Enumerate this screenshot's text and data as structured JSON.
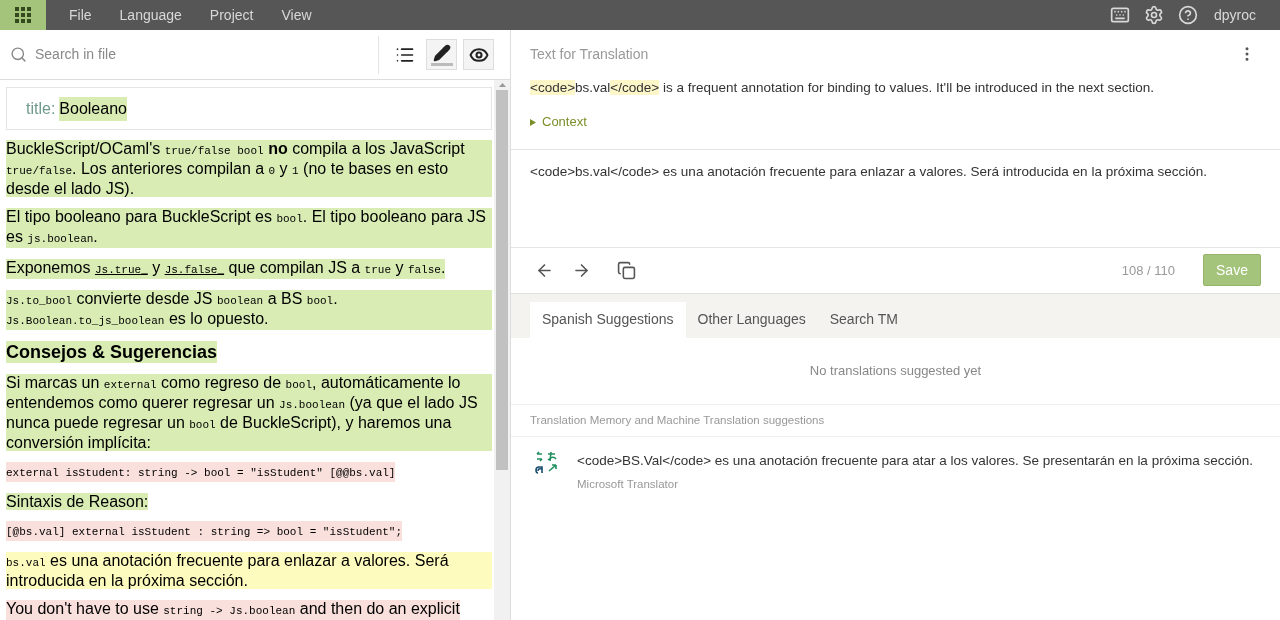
{
  "menu_bar": {
    "items": [
      "File",
      "Language",
      "Project",
      "View"
    ],
    "user": "dpyroc"
  },
  "document": {
    "search": {
      "placeholder": "Search in file"
    },
    "tools": [
      {
        "kind": "list",
        "active": false,
        "selected": false
      },
      {
        "kind": "edit",
        "active": true,
        "selected": true
      },
      {
        "kind": "preview",
        "active": true,
        "selected": false
      }
    ],
    "title_field": {
      "label": "title:",
      "value": "Booleano"
    },
    "blocks": [
      {
        "kind": "paragraph",
        "color": "#d9ecb4",
        "segments": [
          {
            "kind": "text",
            "text": "BuckleScript/OCaml's "
          },
          {
            "kind": "code",
            "text": "true/false bool"
          },
          {
            "kind": "text",
            "text": " **no** compila a los JavaScript "
          },
          {
            "kind": "code",
            "text": "true/false"
          },
          {
            "kind": "text",
            "text": ". Los anteriores compilan a "
          },
          {
            "kind": "code",
            "text": "0"
          },
          {
            "kind": "text",
            "text": " y "
          },
          {
            "kind": "code",
            "text": "1"
          },
          {
            "kind": "text",
            "text": " (no te bases en esto desde el lado JS)."
          }
        ]
      },
      {
        "kind": "paragraph",
        "color": "#d9ecb4",
        "segments": [
          {
            "kind": "text",
            "text": "El tipo booleano para BuckleScript es "
          },
          {
            "kind": "code",
            "text": "bool"
          },
          {
            "kind": "text",
            "text": ". El tipo booleano para JS es "
          },
          {
            "kind": "code",
            "text": "js.boolean"
          },
          {
            "kind": "text",
            "text": "."
          }
        ]
      },
      {
        "kind": "paragraph",
        "color": "#d9ecb4",
        "segments": [
          {
            "kind": "text",
            "text": "Exponemos "
          },
          {
            "kind": "link",
            "text": "Js.true_"
          },
          {
            "kind": "text",
            "text": " y "
          },
          {
            "kind": "link",
            "text": "Js.false_"
          },
          {
            "kind": "text",
            "text": " que compilan JS a "
          },
          {
            "kind": "code",
            "text": "true"
          },
          {
            "kind": "text",
            "text": " y "
          },
          {
            "kind": "code",
            "text": "false"
          },
          {
            "kind": "text",
            "text": "."
          }
        ]
      },
      {
        "kind": "paragraph",
        "color": "#d9ecb4",
        "segments": [
          {
            "kind": "code",
            "text": "Js.to_bool"
          },
          {
            "kind": "text",
            "text": " convierte desde JS "
          },
          {
            "kind": "code",
            "text": "boolean"
          },
          {
            "kind": "text",
            "text": " a BS "
          },
          {
            "kind": "code",
            "text": "bool"
          },
          {
            "kind": "text",
            "text": ". "
          },
          {
            "kind": "code",
            "text": "Js.Boolean.to_js_boolean"
          },
          {
            "kind": "text",
            "text": " es lo opuesto."
          }
        ]
      },
      {
        "kind": "heading",
        "color": "#d9ecb4",
        "segments": [
          {
            "kind": "text",
            "text": "Consejos & Sugerencias"
          }
        ]
      },
      {
        "kind": "paragraph",
        "color": "#d9ecb4",
        "segments": [
          {
            "kind": "text",
            "text": "Si marcas un "
          },
          {
            "kind": "code",
            "text": "external"
          },
          {
            "kind": "text",
            "text": " como regreso de "
          },
          {
            "kind": "code",
            "text": "bool"
          },
          {
            "kind": "text",
            "text": ", automáticamente lo entendemos como querer regresar un "
          },
          {
            "kind": "code",
            "text": "Js.boolean"
          },
          {
            "kind": "text",
            "text": " (ya que el lado JS nunca puede regresar un "
          },
          {
            "kind": "code",
            "text": "bool"
          },
          {
            "kind": "text",
            "text": " de BuckleScript), y haremos una conversión implícita:"
          }
        ]
      },
      {
        "kind": "code_block",
        "color": "#f9e0dc",
        "segments": [
          {
            "kind": "code",
            "text": "external isStudent: string -> bool = \"isStudent\" [@@bs.val]"
          }
        ]
      },
      {
        "kind": "paragraph",
        "color": "#d9ecb4",
        "segments": [
          {
            "kind": "text",
            "text": "Sintaxis de Reason:"
          }
        ]
      },
      {
        "kind": "code_block",
        "color": "#f9e0dc",
        "segments": [
          {
            "kind": "code",
            "text": "[@bs.val] external isStudent : string => bool = \"isStudent\";"
          }
        ]
      },
      {
        "kind": "paragraph",
        "color": "#fdfbbd",
        "segments": [
          {
            "kind": "code",
            "text": "bs.val"
          },
          {
            "kind": "text",
            "text": " es una anotación frecuente para enlazar a valores. Será introducida en la próxima sección."
          }
        ]
      },
      {
        "kind": "paragraph",
        "color": "#f9e0dc",
        "segments": [
          {
            "kind": "text",
            "text": "You don't have to use "
          },
          {
            "kind": "code",
            "text": "string -> Js.boolean"
          },
          {
            "kind": "text",
            "text": " and then do an explicit"
          }
        ]
      }
    ]
  },
  "editor": {
    "header": "Text for Translation",
    "source": [
      {
        "kind": "tag",
        "text": "<code>"
      },
      {
        "kind": "text",
        "text": "bs.val"
      },
      {
        "kind": "tag",
        "text": "</code>"
      },
      {
        "kind": "text",
        "text": " is a frequent annotation for binding to values. It'll be introduced in the next section."
      }
    ],
    "context": {
      "label": "Context",
      "expanded": false
    },
    "translation": {
      "value": "<code>bs.val</code> es una anotación frecuente para enlazar a valores. Será introducida en la próxima sección."
    },
    "counter": "108 / 110",
    "save": "Save"
  },
  "suggestions": {
    "tabs": [
      {
        "label": "Spanish Suggestions",
        "selected": true
      },
      {
        "label": "Other Languages",
        "selected": false
      },
      {
        "label": "Search TM",
        "selected": false
      }
    ],
    "empty": "No translations suggested yet",
    "section": "Translation Memory and Machine Translation suggestions",
    "items": [
      {
        "text": "<code>BS.Val</code> es una anotación frecuente para atar a los valores. Se presentarán en la próxima sección.",
        "source": "Microsoft Translator"
      }
    ]
  }
}
